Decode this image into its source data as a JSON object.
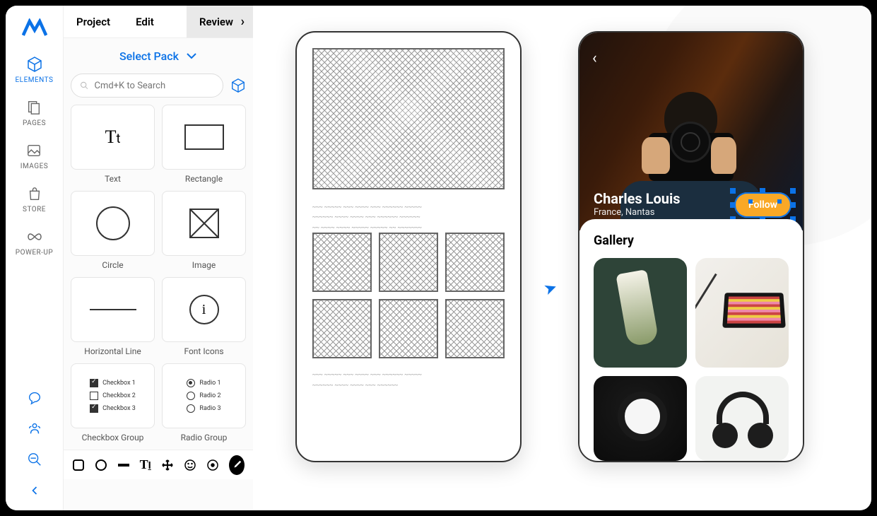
{
  "topbar": {
    "project": "Project",
    "edit": "Edit",
    "review": "Review"
  },
  "sidebar": {
    "items": [
      {
        "label": "ELEMENTS",
        "name": "nav-elements"
      },
      {
        "label": "PAGES",
        "name": "nav-pages"
      },
      {
        "label": "IMAGES",
        "name": "nav-images"
      },
      {
        "label": "STORE",
        "name": "nav-store"
      },
      {
        "label": "POWER-UP",
        "name": "nav-powerup"
      }
    ]
  },
  "select_pack": "Select Pack",
  "search": {
    "placeholder": "Cmd+K to Search"
  },
  "elements": [
    {
      "name": "Text"
    },
    {
      "name": "Rectangle"
    },
    {
      "name": "Circle"
    },
    {
      "name": "Image"
    },
    {
      "name": "Horizontal Line"
    },
    {
      "name": "Font Icons"
    },
    {
      "name": "Checkbox Group"
    },
    {
      "name": "Radio Group"
    }
  ],
  "checkboxes": [
    {
      "label": "Checkbox 1",
      "checked": true
    },
    {
      "label": "Checkbox 2",
      "checked": false
    },
    {
      "label": "Checkbox 3",
      "checked": true
    }
  ],
  "radios": [
    {
      "label": "Radio 1",
      "checked": true
    },
    {
      "label": "Radio 2",
      "checked": false
    },
    {
      "label": "Radio 3",
      "checked": false
    }
  ],
  "preview": {
    "name": "Charles Louis",
    "location": "France, Nantas",
    "follow": "Follow",
    "gallery_title": "Gallery"
  }
}
